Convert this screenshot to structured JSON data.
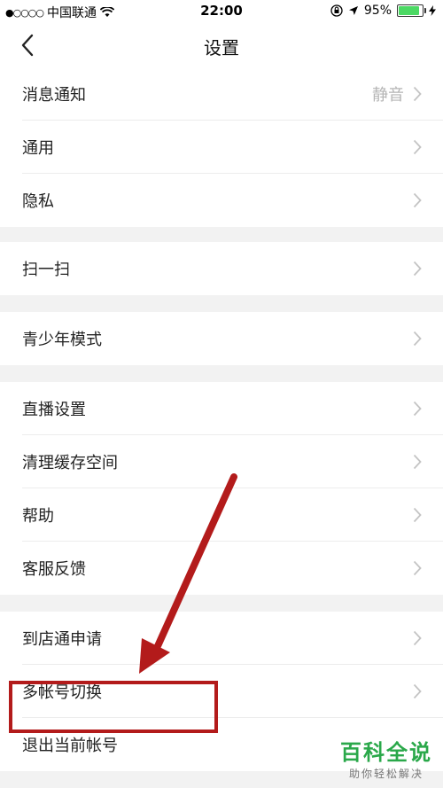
{
  "status_bar": {
    "signal": "●○○○○",
    "carrier": "中国联通",
    "time": "22:00",
    "battery_percent": "95%",
    "battery_level": 0.95
  },
  "nav": {
    "title": "设置"
  },
  "settings": {
    "group1": [
      {
        "label": "消息通知",
        "value": "静音"
      },
      {
        "label": "通用",
        "value": ""
      },
      {
        "label": "隐私",
        "value": ""
      }
    ],
    "group2": [
      {
        "label": "扫一扫"
      }
    ],
    "group3": [
      {
        "label": "青少年模式"
      }
    ],
    "group4": [
      {
        "label": "直播设置"
      },
      {
        "label": "清理缓存空间"
      },
      {
        "label": "帮助"
      },
      {
        "label": "客服反馈"
      }
    ],
    "group5": [
      {
        "label": "到店通申请"
      },
      {
        "label": "多帐号切换"
      },
      {
        "label": "退出当前帐号"
      }
    ]
  },
  "watermark": {
    "title": "百科全说",
    "subtitle": "助你轻松解决"
  },
  "colors": {
    "annotation": "#b31b1b",
    "watermark_green": "#2aa84a"
  }
}
